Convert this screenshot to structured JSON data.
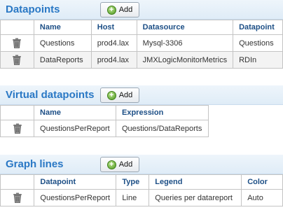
{
  "add_label": "Add",
  "datapoints": {
    "title": "Datapoints",
    "columns": [
      "Name",
      "Host",
      "Datasource",
      "Datapoint"
    ],
    "rows": [
      {
        "name": "Questions",
        "host": "prod4.lax",
        "datasource": "Mysql-3306",
        "datapoint": "Questions"
      },
      {
        "name": "DataReports",
        "host": "prod4.lax",
        "datasource": "JMXLogicMonitorMetrics",
        "datapoint": "RDIn"
      }
    ]
  },
  "virtual": {
    "title": "Virtual datapoints",
    "columns": [
      "Name",
      "Expression"
    ],
    "rows": [
      {
        "name": "QuestionsPerReport",
        "expression": "Questions/DataReports"
      }
    ]
  },
  "graphlines": {
    "title": "Graph lines",
    "columns": [
      "Datapoint",
      "Type",
      "Legend",
      "Color"
    ],
    "rows": [
      {
        "datapoint": "QuestionsPerReport",
        "type": "Line",
        "legend": "Queries per datareport",
        "color": "Auto"
      }
    ]
  },
  "colors": {
    "accent": "#2a78c5",
    "header_text": "#1d4f86",
    "add_icon": "#4f9a22"
  },
  "icons": {
    "delete": "trash-icon",
    "add": "plus-circle-icon"
  }
}
